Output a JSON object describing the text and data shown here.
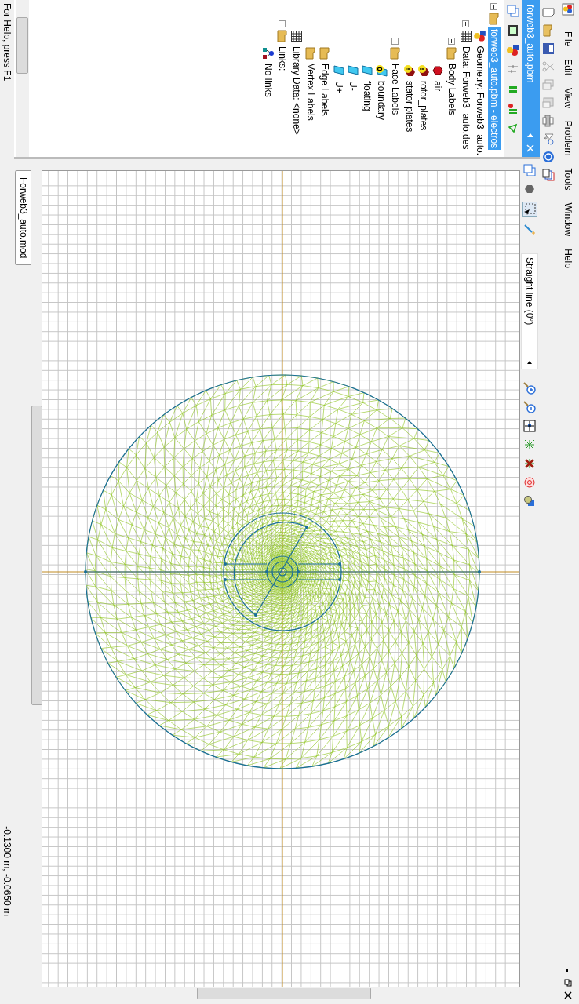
{
  "menu": [
    {
      "label": "File"
    },
    {
      "label": "Edit"
    },
    {
      "label": "View"
    },
    {
      "label": "Problem"
    },
    {
      "label": "Tools"
    },
    {
      "label": "Window"
    },
    {
      "label": "Help"
    }
  ],
  "side_panel": {
    "title": "forweb3_auto.pbm",
    "tree": [
      {
        "label": "forweb3_auto.pbm - electros",
        "kind": "folder",
        "selected": true,
        "expanded": true,
        "children": [
          {
            "label": "Geometry: Forweb3_auto.",
            "kind": "geometry",
            "selected": false
          },
          {
            "label": "Data: Forweb3_auto.des",
            "kind": "table",
            "selected": false,
            "expanded": true,
            "children": [
              {
                "label": "Body Labels",
                "kind": "folder",
                "selected": false,
                "expanded": true,
                "children": [
                  {
                    "label": "air",
                    "kind": "body",
                    "selected": false
                  },
                  {
                    "label": "rotor_plates",
                    "kind": "body-warning",
                    "selected": false
                  },
                  {
                    "label": "stator plates",
                    "kind": "body-warning",
                    "selected": false
                  }
                ]
              },
              {
                "label": "Face Labels",
                "kind": "folder",
                "selected": false,
                "expanded": true,
                "children": [
                  {
                    "label": "boundary",
                    "kind": "face-zero",
                    "selected": false
                  },
                  {
                    "label": "floating",
                    "kind": "face",
                    "selected": false
                  },
                  {
                    "label": "U-",
                    "kind": "face",
                    "selected": false
                  },
                  {
                    "label": "U+",
                    "kind": "face",
                    "selected": false
                  }
                ]
              },
              {
                "label": "Edge Labels",
                "kind": "folder",
                "selected": false
              },
              {
                "label": "Vertex Labels",
                "kind": "folder",
                "selected": false
              }
            ]
          },
          {
            "label": "Library Data: <none>",
            "kind": "table",
            "selected": false
          },
          {
            "label": "Links:",
            "kind": "folder",
            "selected": false,
            "expanded": true,
            "children": [
              {
                "label": "No links",
                "kind": "links",
                "selected": false
              }
            ]
          }
        ]
      }
    ]
  },
  "editor": {
    "draw_mode": "Straight line (0°)",
    "tab": "Forweb3_auto.mod"
  },
  "status_bar": {
    "help": "For Help, press F1",
    "coordinates": "-0.1300 m, -0.0650 m"
  }
}
